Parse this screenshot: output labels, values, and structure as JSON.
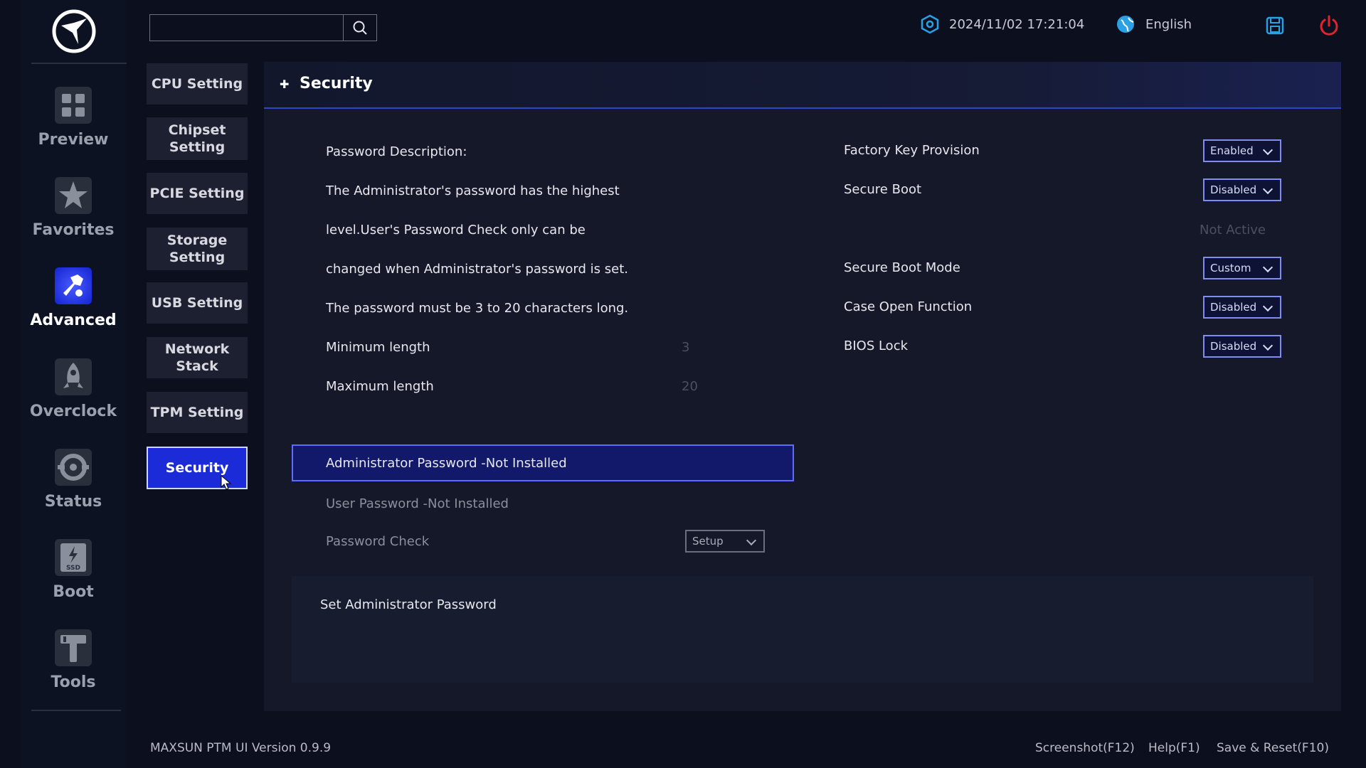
{
  "search": {
    "placeholder": "",
    "value": ""
  },
  "top": {
    "datetime": "2024/11/02 17:21:04",
    "language": "English"
  },
  "nav": {
    "items": [
      {
        "label": "Preview",
        "icon": "grid-icon"
      },
      {
        "label": "Favorites",
        "icon": "star-icon"
      },
      {
        "label": "Advanced",
        "icon": "advanced-tool-icon",
        "active": true
      },
      {
        "label": "Overclock",
        "icon": "rocket-icon"
      },
      {
        "label": "Status",
        "icon": "status-gauge-icon"
      },
      {
        "label": "Boot",
        "icon": "ssd-boot-icon"
      },
      {
        "label": "Tools",
        "icon": "hammer-icon"
      }
    ]
  },
  "submenu": {
    "items": [
      {
        "label": "CPU Setting"
      },
      {
        "label": "Chipset\nSetting"
      },
      {
        "label": "PCIE Setting"
      },
      {
        "label": "Storage\nSetting"
      },
      {
        "label": "USB Setting"
      },
      {
        "label": "Network Stack"
      },
      {
        "label": "TPM Setting"
      },
      {
        "label": "Security",
        "active": true
      }
    ]
  },
  "panel": {
    "title": "Security",
    "left": {
      "desc_title": "Password Description:",
      "desc_line1": "The Administrator's password has the highest",
      "desc_line2": "level.User's Password Check only can be",
      "desc_line3": "changed when Administrator's password is set.",
      "desc_line4": "The password must be 3 to 20 characters long.",
      "min_label": "Minimum length",
      "min_value": "3",
      "max_label": "Maximum length",
      "max_value": "20",
      "admin_password": "Administrator Password -Not Installed",
      "user_password": "User Password -Not Installed",
      "password_check_label": "Password Check",
      "password_check_value": "Setup"
    },
    "right": {
      "factory_key_label": "Factory Key Provision",
      "factory_key_value": "Enabled",
      "secure_boot_label": "Secure Boot",
      "secure_boot_value": "Disabled",
      "secure_boot_status": "Not Active",
      "secure_boot_mode_label": "Secure Boot Mode",
      "secure_boot_mode_value": "Custom",
      "case_open_label": "Case Open Function",
      "case_open_value": "Disabled",
      "bios_lock_label": "BIOS Lock",
      "bios_lock_value": "Disabled"
    },
    "help_text": "Set Administrator Password"
  },
  "footer": {
    "version": "MAXSUN PTM UI Version 0.9.9",
    "screenshot": "Screenshot(F12)",
    "help": "Help(F1)",
    "save_reset": "Save & Reset(F10)"
  },
  "colors": {
    "accent": "#1b2bd8",
    "highlight_border": "#5d6cff",
    "power": "#e0242c",
    "info_icon": "#2aa0e6"
  }
}
